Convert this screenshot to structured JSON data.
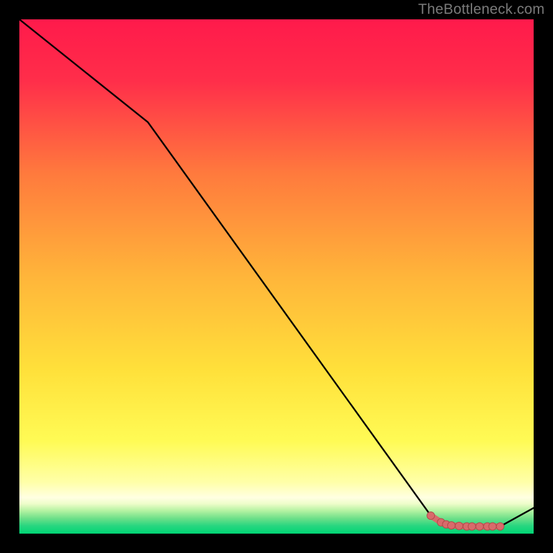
{
  "watermark": "TheBottleneck.com",
  "colors": {
    "frame": "#000000",
    "watermark": "#7a7a7a",
    "curve": "#000000",
    "marker_fill": "#d86b6b",
    "marker_stroke": "#b24a4a",
    "gradient_top": "#ff1a4b",
    "gradient_mid1": "#ff8a3a",
    "gradient_mid2": "#ffe63a",
    "gradient_bottom_yellow": "#ffff9a",
    "green_top": "#d9ffb0",
    "green_mid": "#6fe089",
    "green_bottom": "#00d574"
  },
  "chart_data": {
    "type": "line",
    "title": "",
    "xlabel": "",
    "ylabel": "",
    "xlim": [
      0,
      100
    ],
    "ylim": [
      0,
      100
    ],
    "x": [
      0,
      25,
      80,
      82,
      84,
      86,
      88,
      90,
      92,
      93.5,
      100
    ],
    "values": [
      100,
      80,
      3.5,
      2.2,
      1.6,
      1.4,
      1.4,
      1.4,
      1.4,
      1.4,
      5
    ],
    "markers_x": [
      80,
      82,
      83,
      84,
      85.5,
      87,
      88,
      89.5,
      91,
      92,
      93.5
    ],
    "markers_values": [
      3.5,
      2.2,
      1.8,
      1.6,
      1.5,
      1.4,
      1.4,
      1.4,
      1.4,
      1.4,
      1.4
    ],
    "highlight_band_y": [
      0,
      6
    ]
  }
}
